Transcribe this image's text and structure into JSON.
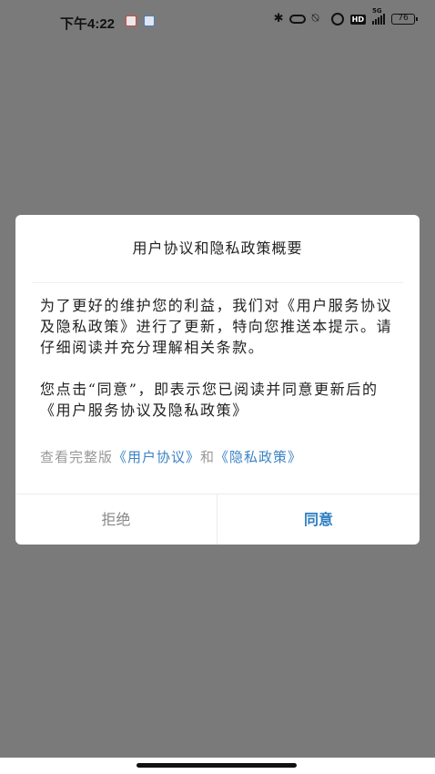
{
  "status_bar": {
    "time": "下午4:22",
    "signal_label": "5G",
    "hd_label": "HD",
    "battery": "76"
  },
  "dialog": {
    "title": "用户协议和隐私政策概要",
    "paragraph_1": "为了更好的维护您的利益，我们对《用户服务协议及隐私政策》进行了更新，特向您推送本提示。请仔细阅读并充分理解相关条款。",
    "paragraph_2": "您点击“同意”，即表示您已阅读并同意更新后的 《用户服务协议及隐私政策》",
    "links_prefix": "查看完整版",
    "user_agreement_link": "《用户协议》",
    "links_and": "和",
    "privacy_policy_link": "《隐私政策》",
    "reject_label": "拒绝",
    "agree_label": "同意"
  },
  "colors": {
    "overlay": "#7a7a7a",
    "link": "#3b83c4",
    "agree": "#2f7fc1"
  }
}
